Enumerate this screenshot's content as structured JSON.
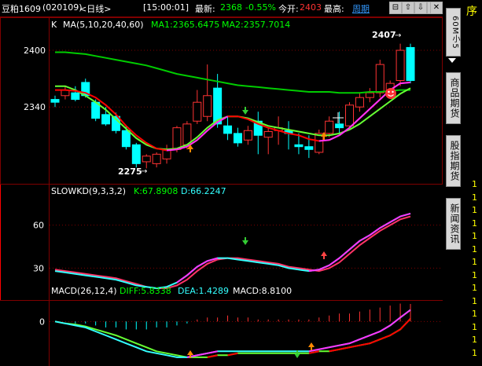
{
  "header": {
    "symbol": "豆粕1609",
    "code": "(020109)",
    "period": "<日线>",
    "time": "[15:00:01]",
    "latest_label": "最新:",
    "latest_value": "2368",
    "change_pct": "-0.55%",
    "open_label": "今开:",
    "open_value": "2403",
    "high_label": "最高:",
    "cycle_button": "周期"
  },
  "nav": {
    "prev_icon": "⊟",
    "up_icon": "⇧",
    "down_icon": "⇩",
    "next_icon": "⊞",
    "close_icon": "✕"
  },
  "right_panel": {
    "corner_label": "序",
    "tabs": [
      "60M小5",
      "商品期货",
      "股指期货",
      "新闻资讯"
    ],
    "digits": [
      "1",
      "1",
      "1",
      "1",
      "1",
      "1",
      "1",
      "1",
      "1",
      "1",
      "1",
      "1",
      "1",
      "1"
    ]
  },
  "kline_panel": {
    "legend_prefix": "K",
    "legend_ma": "MA(5,10,20,40,60)",
    "ma1": "MA1:2365.6475",
    "ma2": "MA2:2357.7014",
    "y_ticks": [
      {
        "label": "2400",
        "value": 2400
      },
      {
        "label": "2340",
        "value": 2340
      }
    ],
    "ylim": [
      2262,
      2420
    ],
    "high_mark": "2407",
    "low_mark": "2275"
  },
  "kd_panel": {
    "title": "SLOWKD(9,3,3,2)",
    "k": "K:67.8908",
    "d": "D:66.2247",
    "y_ticks": [
      {
        "label": "60",
        "value": 60
      },
      {
        "label": "30",
        "value": 30
      }
    ],
    "ylim": [
      10,
      80
    ]
  },
  "macd_panel": {
    "title": "MACD(26,12,4)",
    "diff": "DIFF:5.8338",
    "dea": "DEA:1.4289",
    "macd": "MACD:8.8100",
    "y_ticks": [
      {
        "label": "0",
        "value": 0
      }
    ],
    "ylim": [
      -22,
      10
    ]
  },
  "chart_data": {
    "type": "candlestick",
    "candles": [
      {
        "o": 2348,
        "h": 2352,
        "l": 2340,
        "c": 2345
      },
      {
        "o": 2352,
        "h": 2362,
        "l": 2348,
        "c": 2358
      },
      {
        "o": 2355,
        "h": 2362,
        "l": 2346,
        "c": 2348
      },
      {
        "o": 2366,
        "h": 2370,
        "l": 2350,
        "c": 2352
      },
      {
        "o": 2345,
        "h": 2348,
        "l": 2325,
        "c": 2328
      },
      {
        "o": 2332,
        "h": 2340,
        "l": 2320,
        "c": 2322
      },
      {
        "o": 2330,
        "h": 2334,
        "l": 2312,
        "c": 2315
      },
      {
        "o": 2315,
        "h": 2320,
        "l": 2295,
        "c": 2298
      },
      {
        "o": 2300,
        "h": 2302,
        "l": 2276,
        "c": 2280
      },
      {
        "o": 2282,
        "h": 2290,
        "l": 2275,
        "c": 2288
      },
      {
        "o": 2280,
        "h": 2292,
        "l": 2276,
        "c": 2290
      },
      {
        "o": 2285,
        "h": 2300,
        "l": 2280,
        "c": 2295
      },
      {
        "o": 2295,
        "h": 2320,
        "l": 2292,
        "c": 2318
      },
      {
        "o": 2300,
        "h": 2325,
        "l": 2295,
        "c": 2322
      },
      {
        "o": 2325,
        "h": 2358,
        "l": 2322,
        "c": 2345
      },
      {
        "o": 2330,
        "h": 2385,
        "l": 2325,
        "c": 2352
      },
      {
        "o": 2360,
        "h": 2375,
        "l": 2318,
        "c": 2322
      },
      {
        "o": 2320,
        "h": 2330,
        "l": 2305,
        "c": 2312
      },
      {
        "o": 2312,
        "h": 2318,
        "l": 2298,
        "c": 2302
      },
      {
        "o": 2305,
        "h": 2320,
        "l": 2300,
        "c": 2315
      },
      {
        "o": 2325,
        "h": 2335,
        "l": 2290,
        "c": 2310
      },
      {
        "o": 2308,
        "h": 2318,
        "l": 2290,
        "c": 2314
      },
      {
        "o": 2315,
        "h": 2330,
        "l": 2300,
        "c": 2318
      },
      {
        "o": 2315,
        "h": 2325,
        "l": 2295,
        "c": 2312
      },
      {
        "o": 2300,
        "h": 2312,
        "l": 2290,
        "c": 2298
      },
      {
        "o": 2298,
        "h": 2310,
        "l": 2286,
        "c": 2295
      },
      {
        "o": 2292,
        "h": 2316,
        "l": 2290,
        "c": 2312
      },
      {
        "o": 2312,
        "h": 2330,
        "l": 2308,
        "c": 2325
      },
      {
        "o": 2322,
        "h": 2335,
        "l": 2312,
        "c": 2318
      },
      {
        "o": 2320,
        "h": 2345,
        "l": 2318,
        "c": 2342
      },
      {
        "o": 2340,
        "h": 2355,
        "l": 2335,
        "c": 2350
      },
      {
        "o": 2350,
        "h": 2360,
        "l": 2345,
        "c": 2355
      },
      {
        "o": 2355,
        "h": 2390,
        "l": 2350,
        "c": 2385
      },
      {
        "o": 2355,
        "h": 2368,
        "l": 2352,
        "c": 2365
      },
      {
        "o": 2368,
        "h": 2407,
        "l": 2362,
        "c": 2400
      },
      {
        "o": 2403,
        "h": 2407,
        "l": 2365,
        "c": 2368
      }
    ],
    "ma_green": [
      2398,
      2398,
      2397,
      2396,
      2394,
      2392,
      2390,
      2388,
      2386,
      2384,
      2381,
      2378,
      2375,
      2373,
      2371,
      2369,
      2367,
      2365,
      2363,
      2362,
      2361,
      2360,
      2359,
      2358,
      2357,
      2356,
      2356,
      2356,
      2355,
      2355,
      2355,
      2356,
      2356,
      2357,
      2358,
      2358
    ],
    "ma_lime": [
      2362,
      2362,
      2358,
      2352,
      2345,
      2337,
      2327,
      2317,
      2307,
      2300,
      2296,
      2295,
      2296,
      2300,
      2308,
      2318,
      2326,
      2330,
      2330,
      2328,
      2324,
      2320,
      2318,
      2316,
      2314,
      2312,
      2310,
      2310,
      2312,
      2316,
      2322,
      2330,
      2338,
      2346,
      2354,
      2360
    ],
    "ma_red_magenta": [
      2358,
      2358,
      2357,
      2355,
      2350,
      2342,
      2332,
      2320,
      2310,
      2302,
      2296,
      2294,
      2295,
      2298,
      2305,
      2315,
      2324,
      2330,
      2330,
      2327,
      2322,
      2318,
      2315,
      2312,
      2310,
      2306,
      2304,
      2305,
      2310,
      2318,
      2328,
      2338,
      2348,
      2358,
      2365,
      2366
    ],
    "kd_k": [
      28,
      27,
      26,
      25,
      24,
      23,
      22,
      20,
      18,
      17,
      16,
      17,
      20,
      25,
      31,
      35,
      37,
      37,
      36,
      35,
      34,
      33,
      32,
      30,
      29,
      28,
      29,
      32,
      37,
      43,
      49,
      53,
      58,
      62,
      66,
      68
    ],
    "kd_d": [
      29,
      28,
      27,
      26,
      25,
      24,
      23,
      21,
      19,
      17,
      16,
      16,
      18,
      22,
      28,
      33,
      36,
      37,
      37,
      36,
      35,
      34,
      33,
      31,
      30,
      29,
      28,
      30,
      34,
      40,
      46,
      51,
      56,
      60,
      64,
      66
    ],
    "macd_diff": [
      0,
      -1,
      -2,
      -3,
      -5,
      -7,
      -9,
      -11,
      -13,
      -15,
      -16,
      -17,
      -18,
      -18,
      -17,
      -16,
      -15,
      -15,
      -15,
      -15,
      -15,
      -15,
      -15,
      -15,
      -15,
      -15,
      -14,
      -13,
      -12,
      -11,
      -9,
      -7,
      -5,
      -2,
      2,
      5.8
    ],
    "macd_dea": [
      0,
      -1,
      -1.5,
      -2.5,
      -4,
      -5.5,
      -7,
      -9,
      -11,
      -13,
      -15,
      -16,
      -17,
      -18,
      -18,
      -18,
      -17,
      -17,
      -16,
      -16,
      -16,
      -16,
      -16,
      -16,
      -16,
      -16,
      -15,
      -15,
      -14,
      -13,
      -12,
      -11,
      -9,
      -7,
      -4,
      1.4
    ],
    "macd_hist": [
      0,
      0,
      -1,
      -1,
      -2,
      -3,
      -3,
      -4,
      -4,
      -4,
      -3,
      -3,
      -2,
      -1,
      1,
      2,
      2,
      3,
      2,
      2,
      1,
      1,
      1,
      1,
      1,
      1,
      2,
      3,
      4,
      4,
      5,
      6,
      7,
      8,
      9,
      8.8
    ]
  },
  "colors": {
    "up_candle": "#ff3333",
    "down_candle": "#00ffff",
    "grid": "#7f0000",
    "ma_green": "#00cc00",
    "ma_lime": "#66ff33",
    "ma_red": "#ff0000",
    "ma_magenta": "#ff33ff",
    "kd_k": "#33ffff",
    "kd_d": "#ff3366"
  }
}
